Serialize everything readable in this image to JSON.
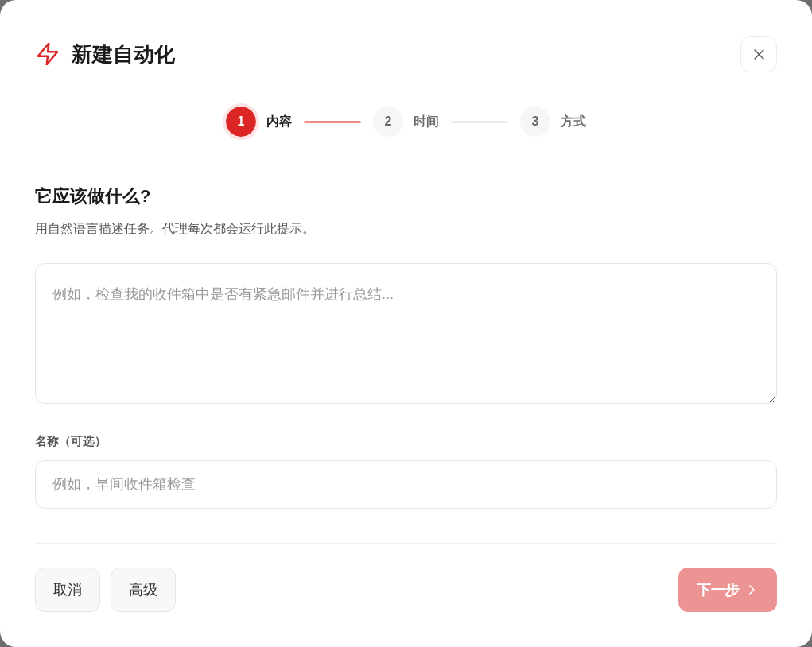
{
  "dialog": {
    "title": "新建自动化"
  },
  "stepper": [
    {
      "number": "1",
      "label": "内容",
      "selected": true
    },
    {
      "number": "2",
      "label": "时间",
      "selected": false
    },
    {
      "number": "3",
      "label": "方式",
      "selected": false
    }
  ],
  "section": {
    "heading": "它应该做什么?",
    "description": "用自然语言描述任务。代理每次都会运行此提示。"
  },
  "prompt_field": {
    "placeholder": "例如，检查我的收件箱中是否有紧急邮件并进行总结..."
  },
  "name_field": {
    "label": "名称（可选）",
    "placeholder": "例如，早间收件箱检查"
  },
  "footer": {
    "buttons": [
      {
        "label": "取消"
      },
      {
        "label": "高级"
      }
    ],
    "next_button": {
      "label": "下一步",
      "disabled": true
    }
  }
}
